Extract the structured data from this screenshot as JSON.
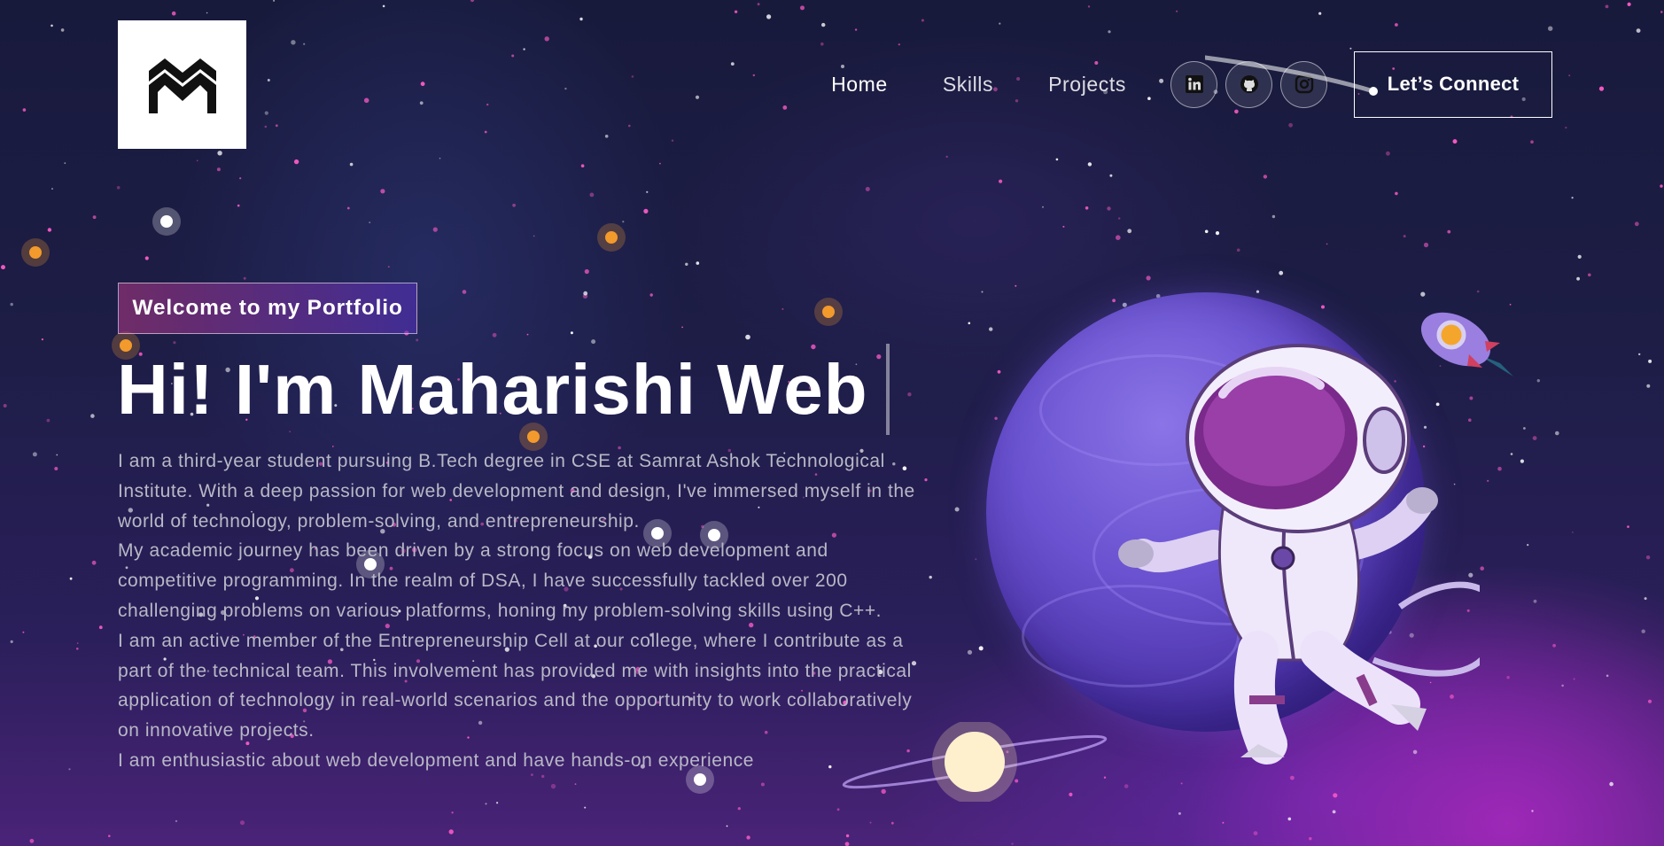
{
  "nav": {
    "links": [
      "Home",
      "Skills",
      "Projects"
    ],
    "connect_label": "Let’s Connect",
    "socials": [
      "linkedin-icon",
      "github-icon",
      "instagram-icon"
    ]
  },
  "hero": {
    "tagline": "Welcome to my Portfolio",
    "headline": "Hi! I'm Maharishi Web",
    "paragraphs": [
      "I am a third-year student pursuing B.Tech degree in CSE at Samrat Ashok Technological Institute. With a deep passion for web development and design, I've immersed myself in the world of technology, problem-solving, and entrepreneurship.",
      "My academic journey has been driven by a strong focus on web development and competitive programming. In the realm of DSA, I have successfully tackled over 200 challenging problems on various platforms, honing my problem-solving skills using C++.",
      "I am an active member of the Entrepreneurship Cell at our college, where I contribute as a part of the technical team. This involvement has provided me with insights into the practical application of technology in real-world scenarios and the opportunity to work collaboratively on innovative projects.",
      "I am enthusiastic about web development and have hands-on experience"
    ]
  },
  "colors": {
    "accent_gradient_start": "#AA367C",
    "accent_gradient_end": "#4A2FBD",
    "background": "#1b1c40"
  }
}
